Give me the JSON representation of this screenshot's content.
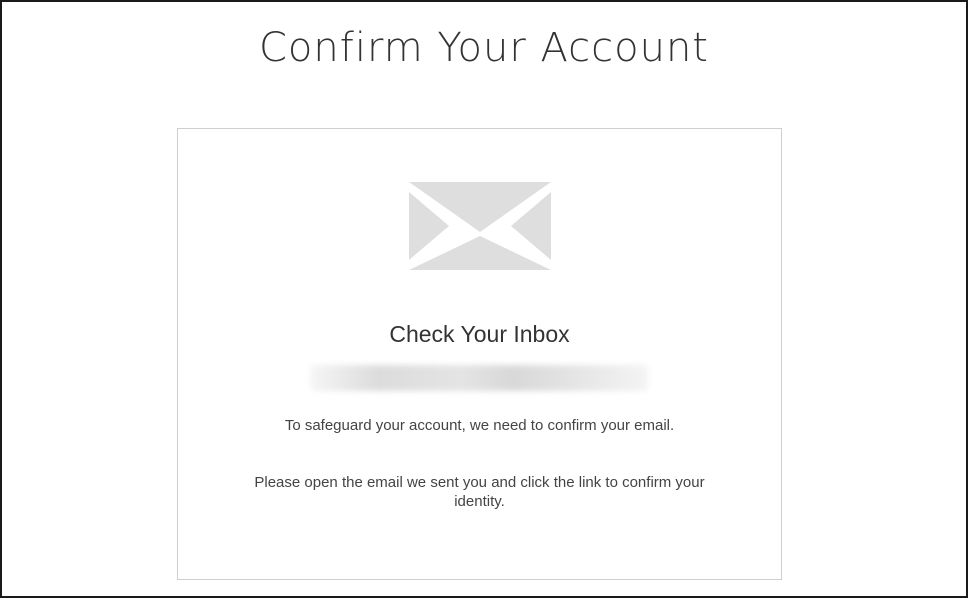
{
  "page": {
    "title": "Confirm Your Account"
  },
  "card": {
    "icon": "envelope-icon",
    "heading": "Check Your Inbox",
    "email": "",
    "message_1": "To safeguard your account, we need to confirm your email.",
    "message_2": "Please open the email we sent you and click the link to confirm your identity."
  },
  "colors": {
    "title_text": "#333333",
    "body_text": "#444444",
    "card_border": "#cfcfcf",
    "icon_fill": "#dedede",
    "frame_border": "#1a1a1a"
  }
}
